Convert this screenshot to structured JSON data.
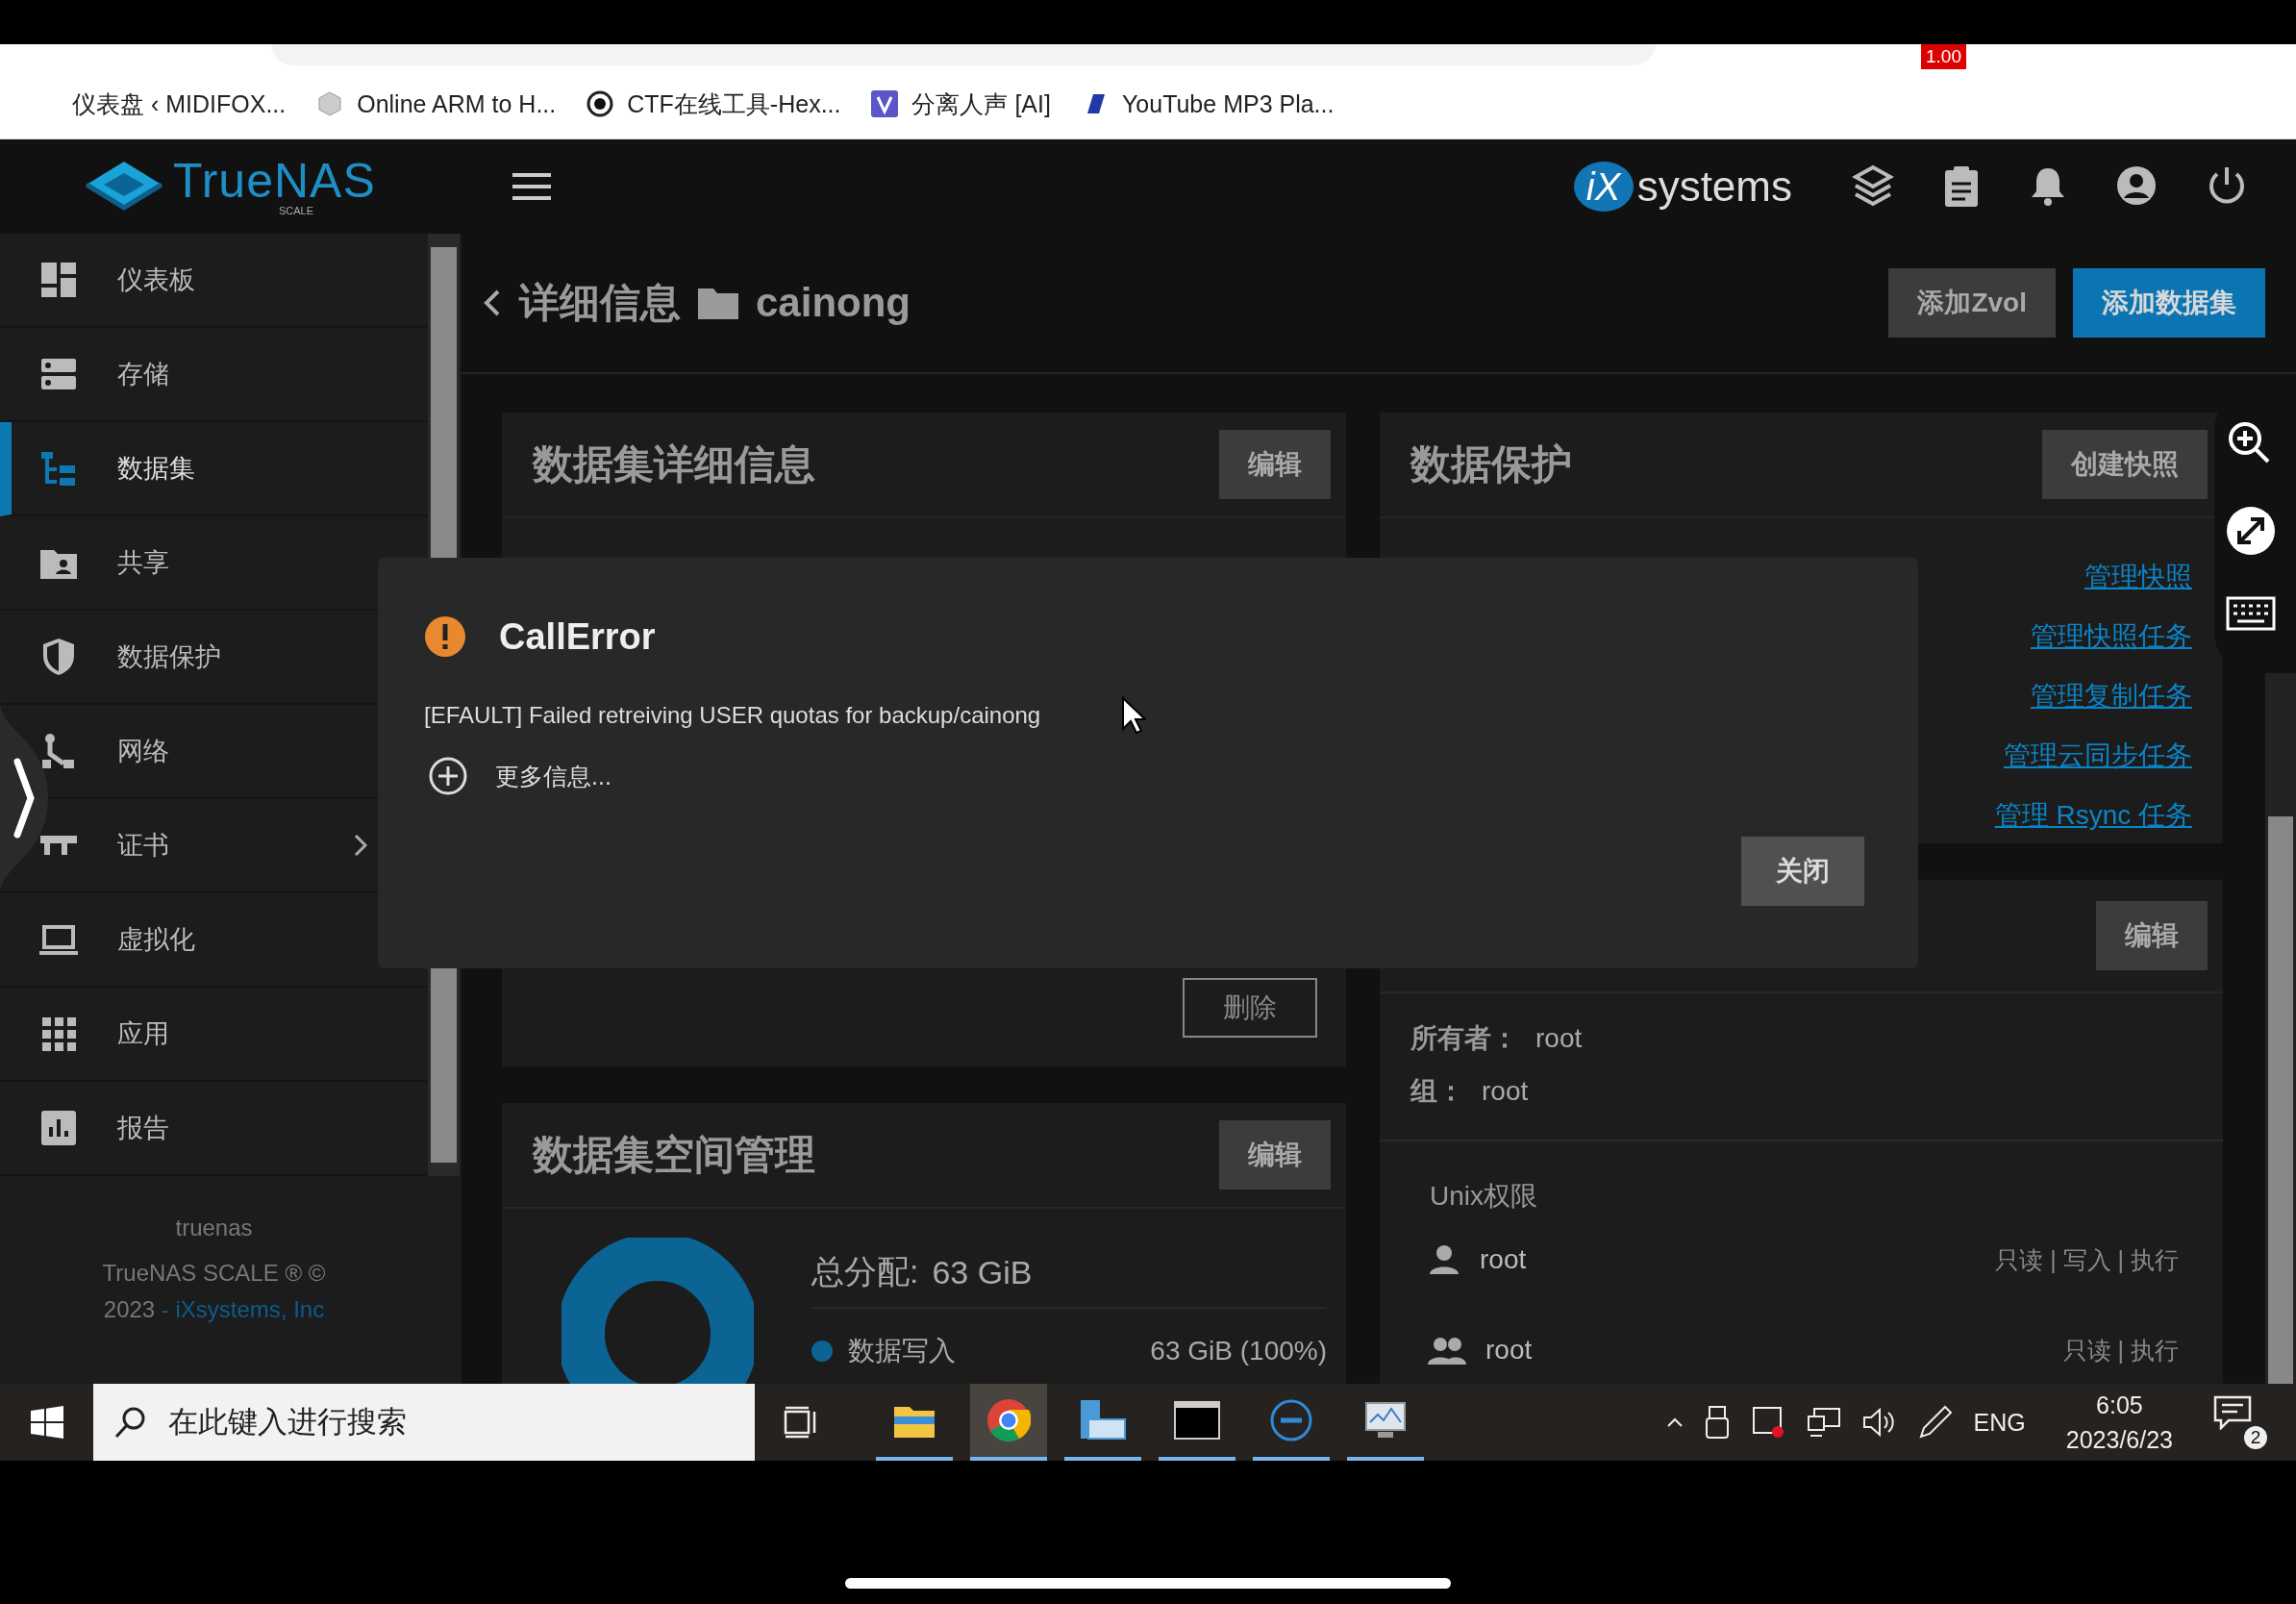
{
  "browser": {
    "bookmarks": [
      {
        "label": "仪表盘 ‹ MIDIFOX...",
        "kind": "page"
      },
      {
        "label": "Online ARM to H...",
        "kind": "cube"
      },
      {
        "label": "CTF在线工具-Hex...",
        "kind": "eye"
      },
      {
        "label": "分离人声 [AI]",
        "kind": "letter"
      },
      {
        "label": "YouTube MP3 Pla...",
        "kind": "note"
      }
    ],
    "extension_badge": "1.00"
  },
  "header": {
    "logo": "TrueNAS",
    "logo_sub": "SCALE",
    "brand_mark": "iX",
    "brand": "systems"
  },
  "sidebar": {
    "items": [
      {
        "label": "仪表板",
        "selected": false,
        "has_submenu": false
      },
      {
        "label": "存储",
        "selected": false,
        "has_submenu": false
      },
      {
        "label": "数据集",
        "selected": true,
        "has_submenu": false
      },
      {
        "label": "共享",
        "selected": false,
        "has_submenu": false
      },
      {
        "label": "数据保护",
        "selected": false,
        "has_submenu": false
      },
      {
        "label": "网络",
        "selected": false,
        "has_submenu": false
      },
      {
        "label": "证书",
        "selected": false,
        "has_submenu": true
      },
      {
        "label": "虚拟化",
        "selected": false,
        "has_submenu": false
      },
      {
        "label": "应用",
        "selected": false,
        "has_submenu": false
      },
      {
        "label": "报告",
        "selected": false,
        "has_submenu": false
      }
    ],
    "hostname": "truenas",
    "product": "TrueNAS SCALE ® ©",
    "year": "2023",
    "company_link": "- iXsystems, Inc"
  },
  "page": {
    "title": "详细信息",
    "dataset": "cainong",
    "buttons": [
      {
        "label": "添加Zvol",
        "primary": false
      },
      {
        "label": "添加数据集",
        "primary": true
      }
    ]
  },
  "details_card": {
    "title": "数据集详细信息",
    "edit": "编辑",
    "delete": "删除"
  },
  "space_card": {
    "title": "数据集空间管理",
    "edit": "编辑",
    "total_label": "总分配:",
    "total": "63 GiB",
    "legend": [
      {
        "label": "数据写入",
        "value": "63 GiB (100%)",
        "color": "#0b6494"
      }
    ]
  },
  "protection_card": {
    "title": "数据保护",
    "button": "创建快照",
    "links": [
      "管理快照",
      "管理快照任务",
      "管理复制任务",
      "管理云同步任务",
      "管理 Rsync 任务"
    ]
  },
  "permissions_card": {
    "edit": "编辑",
    "owner_label": "所有者：",
    "owner": "root",
    "group_label": "组：",
    "group": "root",
    "unix_title": "Unix权限",
    "entries": [
      {
        "kind": "user",
        "name": "root",
        "perms": "只读 | 写入 | 执行"
      },
      {
        "kind": "group",
        "name": "root",
        "perms": "只读 | 执行"
      }
    ]
  },
  "dialog": {
    "title": "CallError",
    "message": "[EFAULT] Failed retreiving USER quotas for backup/cainong",
    "more": "更多信息...",
    "close": "关闭"
  },
  "taskbar": {
    "search": {
      "placeholder": "在此键入进行搜索"
    },
    "apps": [
      {
        "kind": "explorer",
        "selected": false
      },
      {
        "kind": "chrome",
        "selected": true
      },
      {
        "kind": "server",
        "selected": false
      },
      {
        "kind": "terminal",
        "selected": false
      },
      {
        "kind": "dell",
        "selected": false
      },
      {
        "kind": "monitor",
        "selected": false
      }
    ],
    "language": "ENG",
    "time": "6:05",
    "date": "2023/6/23",
    "notifications": "2"
  }
}
